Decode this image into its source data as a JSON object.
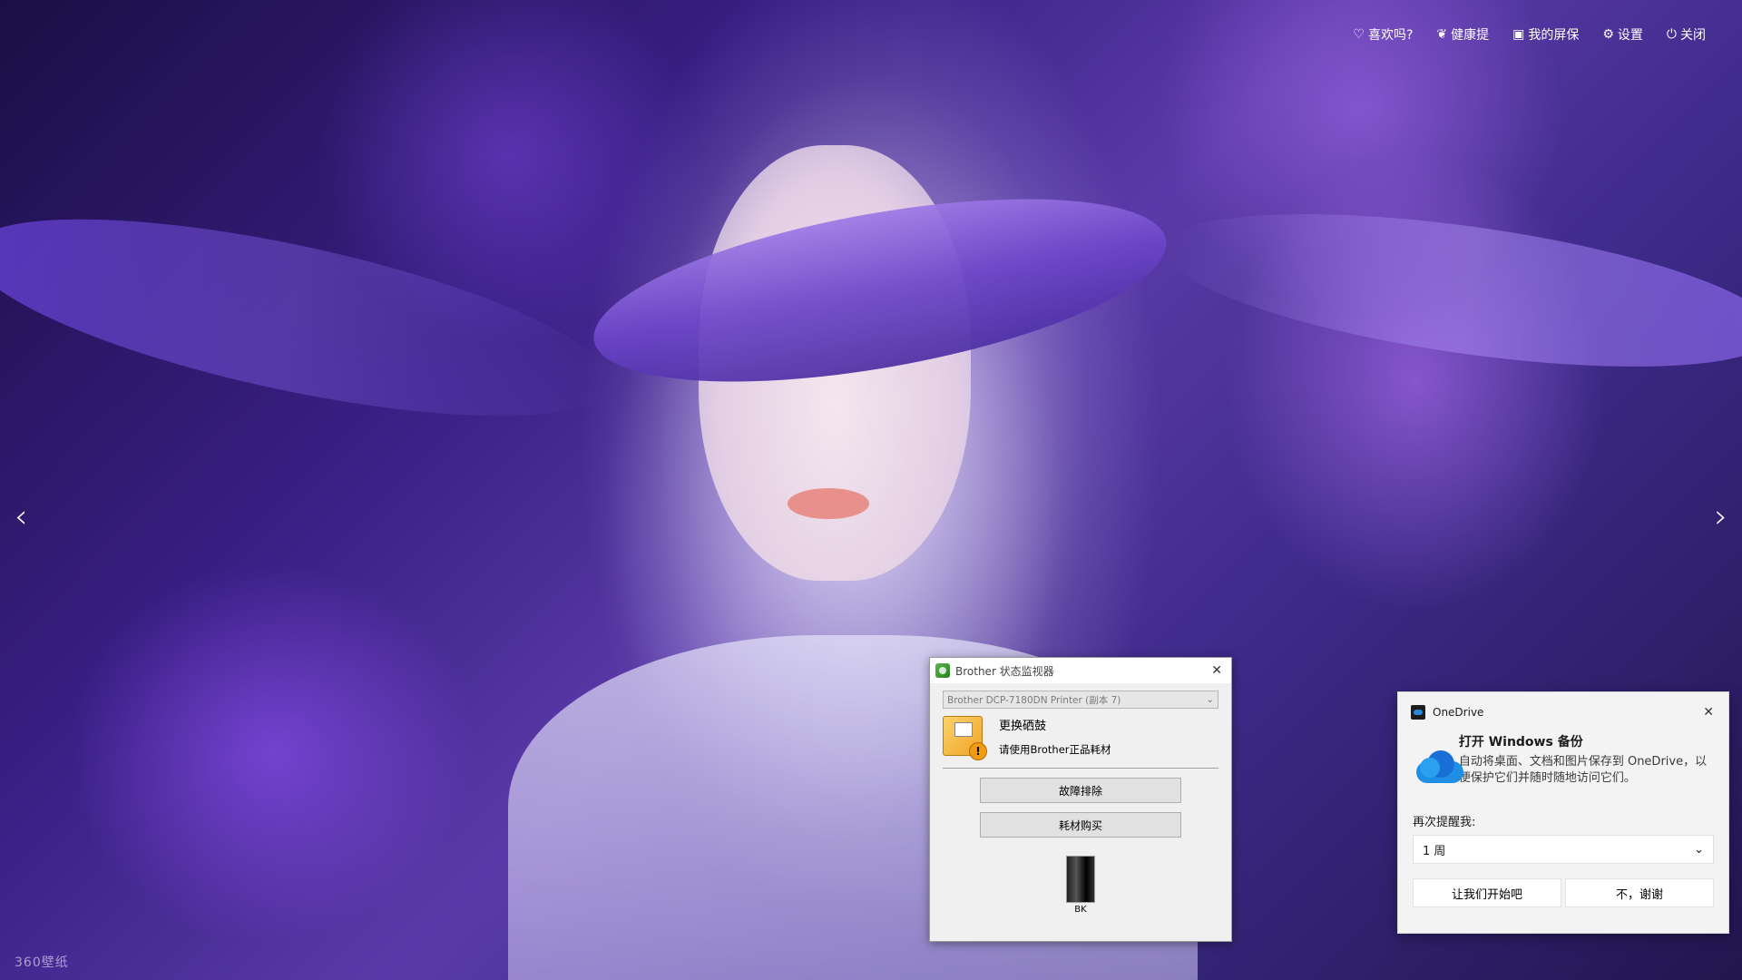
{
  "topbar": {
    "items": [
      {
        "label": "喜欢吗?",
        "icon": "heart-icon"
      },
      {
        "label": "健康提",
        "icon": "leaf-icon"
      },
      {
        "label": "我的屏保",
        "icon": "image-icon"
      },
      {
        "label": "设置",
        "icon": "gear-icon"
      },
      {
        "label": "关闭",
        "icon": "power-icon"
      }
    ]
  },
  "nav": {
    "prev": "‹",
    "next": "›"
  },
  "watermark": "360壁纸",
  "brother": {
    "title": "Brother 状态监视器",
    "printer_select": "Brother DCP-7180DN Printer (副本 7)",
    "status_main": "更换硒鼓",
    "status_sub": "请使用Brother正品耗材",
    "btn_troubleshoot": "故障排除",
    "btn_supplies": "耗材购买",
    "ink_label": "BK"
  },
  "onedrive": {
    "app_name": "OneDrive",
    "title": "打开 Windows 备份",
    "description": "自动将桌面、文档和图片保存到 OneDrive，以便保护它们并随时随地访问它们。",
    "remind_label": "再次提醒我:",
    "remind_value": "1 周",
    "btn_start": "让我们开始吧",
    "btn_decline": "不，谢谢"
  }
}
